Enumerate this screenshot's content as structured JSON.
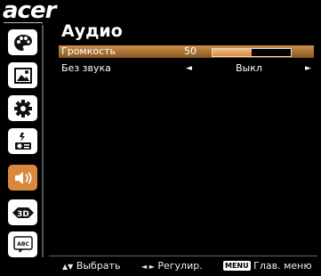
{
  "brand": "acer",
  "page": {
    "title": "Аудио"
  },
  "sidebar": {
    "items": [
      {
        "icon": "palette-icon"
      },
      {
        "icon": "picture-icon"
      },
      {
        "icon": "gear-icon"
      },
      {
        "icon": "projector-icon"
      },
      {
        "icon": "speaker-icon",
        "active": true
      },
      {
        "icon": "3d-icon",
        "label": "3D"
      },
      {
        "icon": "language-icon",
        "label": "ABC"
      }
    ]
  },
  "settings": {
    "volume": {
      "label": "Громкость",
      "value": "50",
      "level": 0.5
    },
    "mute": {
      "label": "Без звука",
      "value": "Выкл",
      "left_arrow": "◄",
      "right_arrow": "►"
    }
  },
  "footer": {
    "select": {
      "keys": "▲▼",
      "label": "Выбрать"
    },
    "adjust": {
      "keys": "◄ ►",
      "label": "Регулир."
    },
    "menu": {
      "key": "MENU",
      "label": "Глав. меню"
    }
  },
  "colors": {
    "accent": "#d9883e",
    "background": "#000000"
  }
}
